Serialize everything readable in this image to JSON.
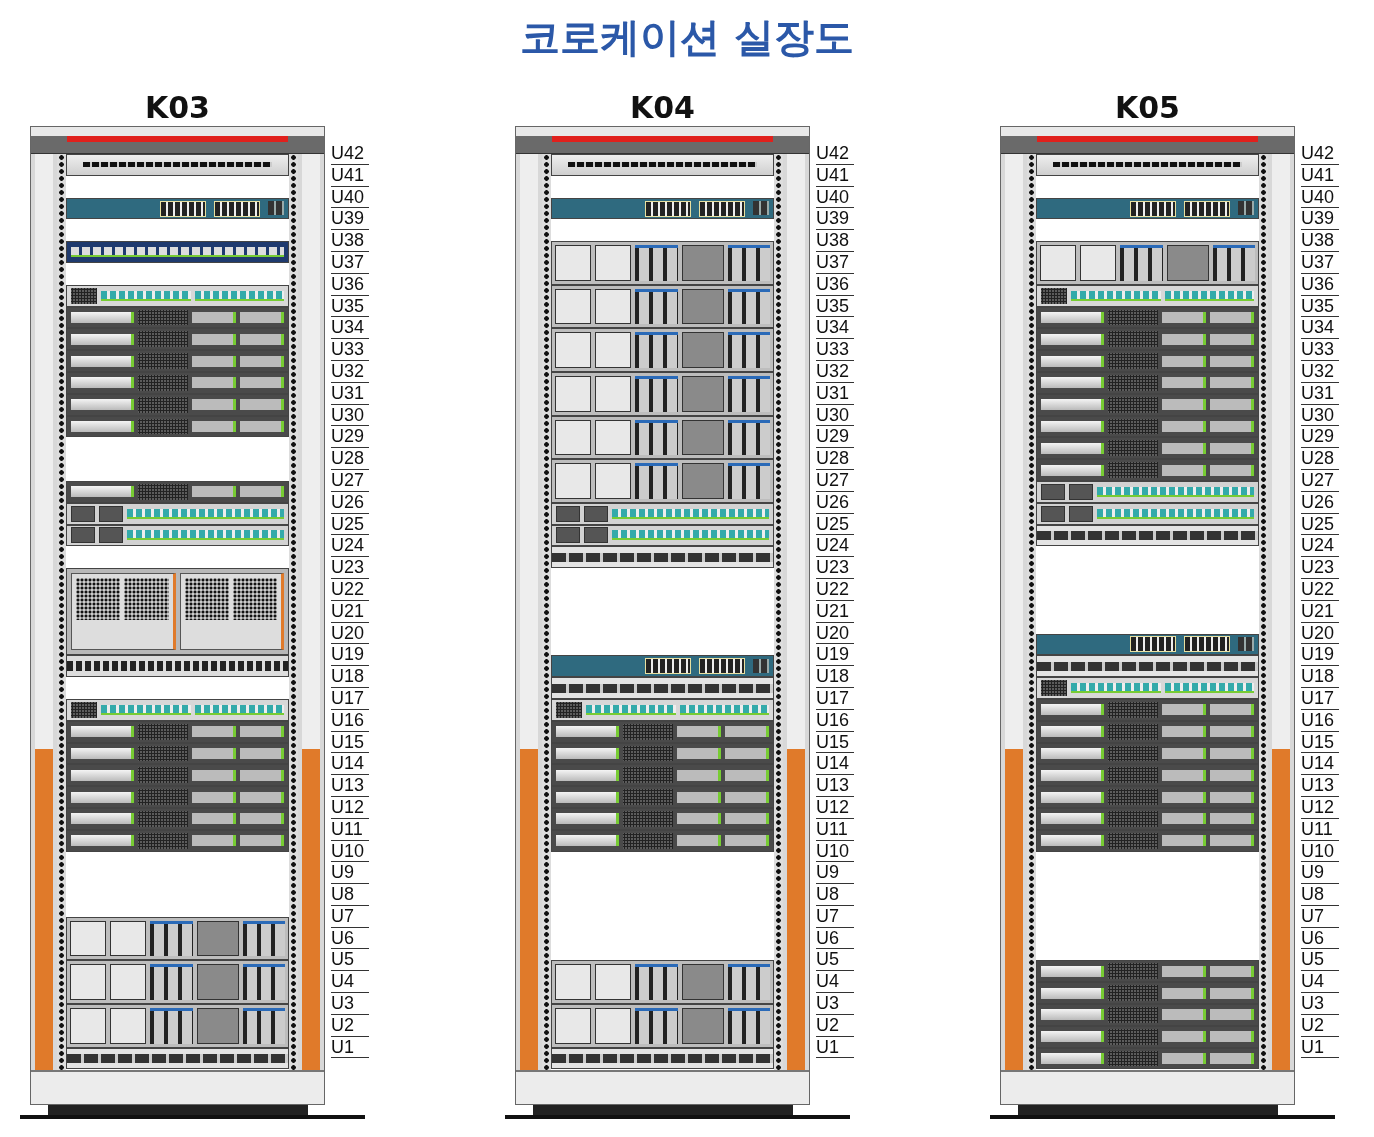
{
  "title": "코로케이션 실장도",
  "racks": [
    {
      "name": "K03",
      "units": [
        "U42",
        "U41",
        "U40",
        "U39",
        "U38",
        "U37",
        "U36",
        "U35",
        "U34",
        "U33",
        "U32",
        "U31",
        "U30",
        "U29",
        "U28",
        "U27",
        "U26",
        "U25",
        "U24",
        "U23",
        "U22",
        "U21",
        "U20",
        "U19",
        "U18",
        "U17",
        "U16",
        "U15",
        "U14",
        "U13",
        "U12",
        "U11",
        "U10",
        "U9",
        "U8",
        "U7",
        "U6",
        "U5",
        "U4",
        "U3",
        "U2",
        "U1"
      ],
      "devices": [
        {
          "kind": "patch"
        },
        {
          "kind": "empty"
        },
        {
          "kind": "switch"
        },
        {
          "kind": "empty"
        },
        {
          "kind": "appliance"
        },
        {
          "kind": "empty"
        },
        {
          "kind": "controller"
        },
        {
          "kind": "server1u"
        },
        {
          "kind": "server1u"
        },
        {
          "kind": "server1u"
        },
        {
          "kind": "server1u"
        },
        {
          "kind": "server1u"
        },
        {
          "kind": "server1u"
        },
        {
          "kind": "empty"
        },
        {
          "kind": "empty"
        },
        {
          "kind": "server1u"
        },
        {
          "kind": "dualnode"
        },
        {
          "kind": "dualnode"
        },
        {
          "kind": "empty"
        },
        {
          "kind": "storage"
        },
        {
          "kind": "ports48"
        },
        {
          "kind": "empty"
        },
        {
          "kind": "controller"
        },
        {
          "kind": "server1u"
        },
        {
          "kind": "server1u"
        },
        {
          "kind": "server1u"
        },
        {
          "kind": "server1u"
        },
        {
          "kind": "server1u"
        },
        {
          "kind": "server1u"
        },
        {
          "kind": "empty"
        },
        {
          "kind": "empty"
        },
        {
          "kind": "empty"
        },
        {
          "kind": "server2u"
        },
        {
          "kind": "server2u"
        },
        {
          "kind": "server2u"
        },
        {
          "kind": "fabric"
        }
      ]
    },
    {
      "name": "K04",
      "units": [
        "U42",
        "U41",
        "U40",
        "U39",
        "U38",
        "U37",
        "U36",
        "U35",
        "U34",
        "U33",
        "U32",
        "U31",
        "U30",
        "U29",
        "U28",
        "U27",
        "U26",
        "U25",
        "U24",
        "U23",
        "U22",
        "U21",
        "U20",
        "U19",
        "U18",
        "U17",
        "U16",
        "U15",
        "U14",
        "U13",
        "U12",
        "U11",
        "U10",
        "U9",
        "U8",
        "U7",
        "U6",
        "U5",
        "U4",
        "U3",
        "U2",
        "U1"
      ],
      "devices": [
        {
          "kind": "patch"
        },
        {
          "kind": "empty"
        },
        {
          "kind": "switch"
        },
        {
          "kind": "empty"
        },
        {
          "kind": "server2u"
        },
        {
          "kind": "server2u"
        },
        {
          "kind": "server2u"
        },
        {
          "kind": "server2u"
        },
        {
          "kind": "server2u"
        },
        {
          "kind": "server2u"
        },
        {
          "kind": "dualnode"
        },
        {
          "kind": "dualnode"
        },
        {
          "kind": "fabric"
        },
        {
          "kind": "empty"
        },
        {
          "kind": "empty"
        },
        {
          "kind": "empty"
        },
        {
          "kind": "empty"
        },
        {
          "kind": "switch"
        },
        {
          "kind": "fabric"
        },
        {
          "kind": "controller"
        },
        {
          "kind": "server1u"
        },
        {
          "kind": "server1u"
        },
        {
          "kind": "server1u"
        },
        {
          "kind": "server1u"
        },
        {
          "kind": "server1u"
        },
        {
          "kind": "server1u"
        },
        {
          "kind": "empty"
        },
        {
          "kind": "empty"
        },
        {
          "kind": "empty"
        },
        {
          "kind": "empty"
        },
        {
          "kind": "empty"
        },
        {
          "kind": "server2u"
        },
        {
          "kind": "server2u"
        },
        {
          "kind": "fabric"
        }
      ]
    },
    {
      "name": "K05",
      "units": [
        "U42",
        "U41",
        "U40",
        "U39",
        "U38",
        "U37",
        "U36",
        "U35",
        "U34",
        "U33",
        "U32",
        "U31",
        "U30",
        "U29",
        "U28",
        "U27",
        "U26",
        "U25",
        "U24",
        "U23",
        "U22",
        "U21",
        "U20",
        "U19",
        "U18",
        "U17",
        "U16",
        "U15",
        "U14",
        "U13",
        "U12",
        "U11",
        "U10",
        "U9",
        "U8",
        "U7",
        "U6",
        "U5",
        "U4",
        "U3",
        "U2",
        "U1"
      ],
      "devices": [
        {
          "kind": "patch"
        },
        {
          "kind": "empty"
        },
        {
          "kind": "switch"
        },
        {
          "kind": "empty"
        },
        {
          "kind": "server2u"
        },
        {
          "kind": "controller"
        },
        {
          "kind": "server1u"
        },
        {
          "kind": "server1u"
        },
        {
          "kind": "server1u"
        },
        {
          "kind": "server1u"
        },
        {
          "kind": "server1u"
        },
        {
          "kind": "server1u"
        },
        {
          "kind": "server1u"
        },
        {
          "kind": "server1u"
        },
        {
          "kind": "dualnode"
        },
        {
          "kind": "dualnode"
        },
        {
          "kind": "fabric"
        },
        {
          "kind": "empty"
        },
        {
          "kind": "empty"
        },
        {
          "kind": "empty"
        },
        {
          "kind": "empty"
        },
        {
          "kind": "switch"
        },
        {
          "kind": "fabric"
        },
        {
          "kind": "controller"
        },
        {
          "kind": "server1u"
        },
        {
          "kind": "server1u"
        },
        {
          "kind": "server1u"
        },
        {
          "kind": "server1u"
        },
        {
          "kind": "server1u"
        },
        {
          "kind": "server1u"
        },
        {
          "kind": "server1u"
        },
        {
          "kind": "empty"
        },
        {
          "kind": "empty"
        },
        {
          "kind": "empty"
        },
        {
          "kind": "empty"
        },
        {
          "kind": "empty"
        },
        {
          "kind": "server1u"
        },
        {
          "kind": "server1u"
        },
        {
          "kind": "server1u"
        },
        {
          "kind": "server1u"
        },
        {
          "kind": "server1u"
        }
      ]
    }
  ]
}
